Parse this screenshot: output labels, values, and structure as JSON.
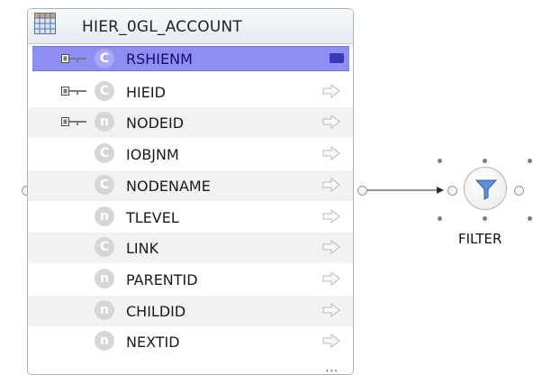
{
  "table": {
    "title": "HIER_0GL_ACCOUNT",
    "icon": "table-grid-icon",
    "more_indicator": "...",
    "columns": [
      {
        "name": "RSHIENM",
        "type": "C",
        "key": true,
        "selected": true
      },
      {
        "name": "HIEID",
        "type": "C",
        "key": true,
        "selected": false
      },
      {
        "name": "NODEID",
        "type": "n",
        "key": true,
        "selected": false
      },
      {
        "name": "IOBJNM",
        "type": "C",
        "key": false,
        "selected": false
      },
      {
        "name": "NODENAME",
        "type": "C",
        "key": false,
        "selected": false
      },
      {
        "name": "TLEVEL",
        "type": "n",
        "key": false,
        "selected": false
      },
      {
        "name": "LINK",
        "type": "C",
        "key": false,
        "selected": false
      },
      {
        "name": "PARENTID",
        "type": "n",
        "key": false,
        "selected": false
      },
      {
        "name": "CHILDID",
        "type": "n",
        "key": false,
        "selected": false
      },
      {
        "name": "NEXTID",
        "type": "n",
        "key": false,
        "selected": false
      }
    ]
  },
  "filter": {
    "label": "FILTER",
    "icon": "funnel-icon"
  },
  "colors": {
    "selection": "#8f8ff3",
    "funnel": "#5b8fd6",
    "key": "#6b7d95"
  }
}
